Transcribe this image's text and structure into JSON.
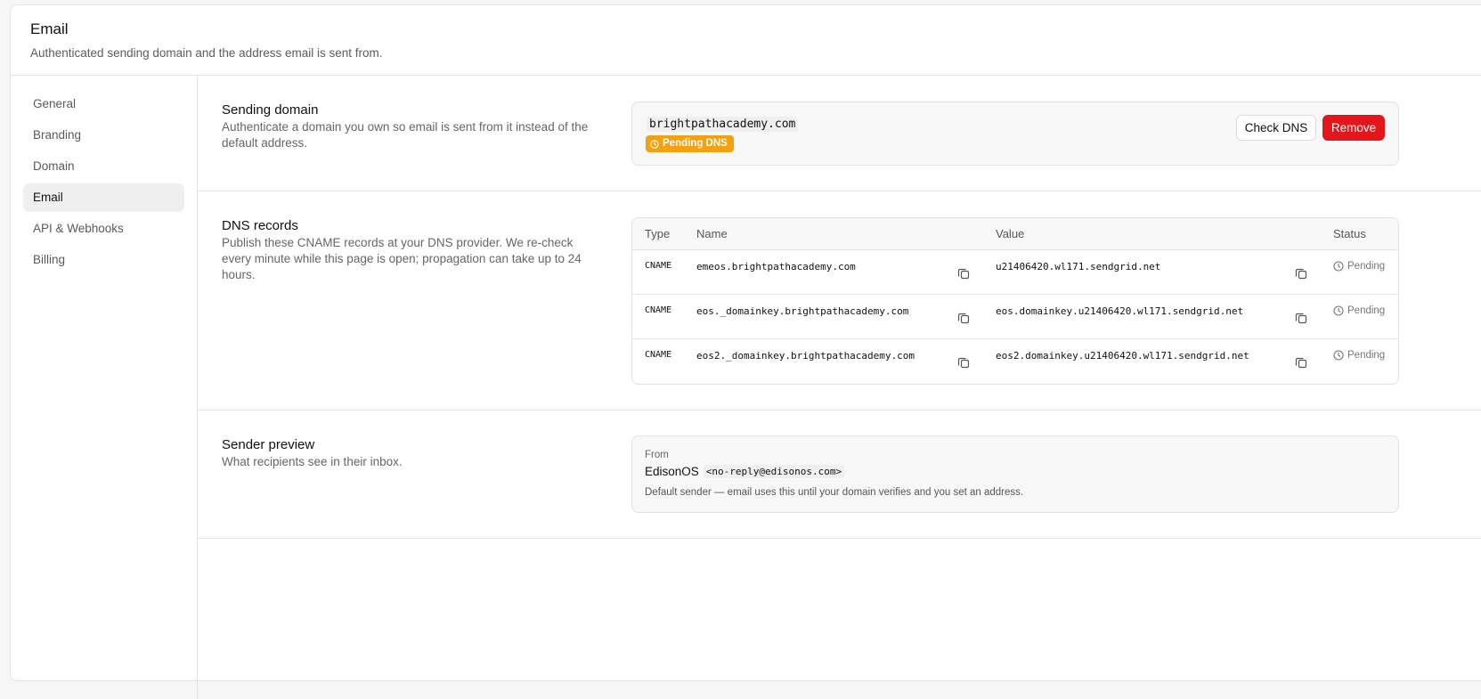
{
  "header": {
    "title": "Email",
    "subtitle": "Authenticated sending domain and the address email is sent from."
  },
  "sidebar": {
    "items": [
      {
        "label": "General"
      },
      {
        "label": "Branding"
      },
      {
        "label": "Domain"
      },
      {
        "label": "Email"
      },
      {
        "label": "API & Webhooks"
      },
      {
        "label": "Billing"
      }
    ],
    "active": "Email"
  },
  "sending_domain": {
    "title": "Sending domain",
    "description": "Authenticate a domain you own so email is sent from it instead of the default address.",
    "domain": "brightpathacademy.com",
    "badge": "Pending DNS",
    "badge_color": "#f5a00f",
    "check_label": "Check DNS",
    "remove_label": "Remove",
    "remove_color": "#e4161b"
  },
  "dns_records": {
    "title": "DNS records",
    "description": "Publish these CNAME records at your DNS provider. We re-check every minute while this page is open; propagation can take up to 24 hours.",
    "columns": {
      "type": "Type",
      "name": "Name",
      "value": "Value",
      "status": "Status"
    },
    "rows": [
      {
        "type": "CNAME",
        "name": "emeos.brightpathacademy.com",
        "value": "u21406420.wl171.sendgrid.net",
        "status": "Pending"
      },
      {
        "type": "CNAME",
        "name": "eos._domainkey.brightpathacademy.com",
        "value": "eos.domainkey.u21406420.wl171.sendgrid.net",
        "status": "Pending"
      },
      {
        "type": "CNAME",
        "name": "eos2._domainkey.brightpathacademy.com",
        "value": "eos2.domainkey.u21406420.wl171.sendgrid.net",
        "status": "Pending"
      }
    ]
  },
  "sender_preview": {
    "title": "Sender preview",
    "description": "What recipients see in their inbox.",
    "from_label": "From",
    "sender_name": "EdisonOS",
    "sender_address": "<no-reply@edisonos.com>",
    "note": "Default sender — email uses this until your domain verifies and you set an address."
  },
  "icons": {
    "copy": "copy-icon",
    "clock": "clock-icon"
  }
}
